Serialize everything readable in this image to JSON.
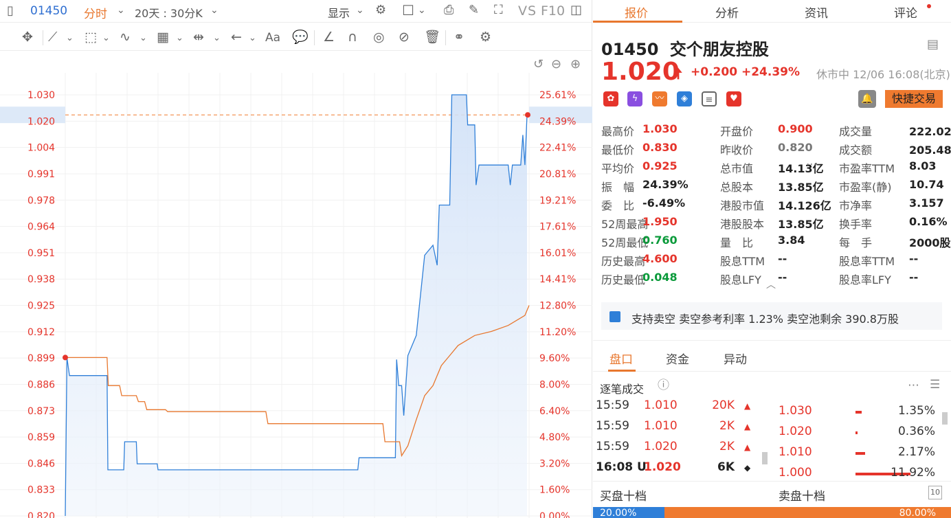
{
  "toolbar": {
    "code": "01450",
    "period": "分时",
    "range": "20天 : 30分K",
    "display": "显示",
    "vs": "VS",
    "f10": "F10",
    "text_tool": "Aa"
  },
  "chart": {
    "left_axis": [
      "1.030",
      "1.020",
      "1.004",
      "0.991",
      "0.978",
      "0.964",
      "0.951",
      "0.938",
      "0.925",
      "0.912",
      "0.899",
      "0.886",
      "0.873",
      "0.859",
      "0.846",
      "0.833",
      "0.820"
    ],
    "right_axis": [
      "25.61%",
      "24.39%",
      "22.41%",
      "20.81%",
      "19.21%",
      "17.61%",
      "16.01%",
      "14.41%",
      "12.80%",
      "11.20%",
      "9.60%",
      "8.00%",
      "6.40%",
      "4.80%",
      "3.20%",
      "1.60%",
      "0.00%"
    ],
    "current_price_label": "1.020",
    "current_pct_label": "24.39%"
  },
  "chart_data": {
    "type": "line",
    "ylim": [
      0.82,
      1.03
    ],
    "series": [],
    "price_points": [
      [
        0,
        0.82
      ],
      [
        0.4,
        0.899
      ],
      [
        1,
        0.89
      ],
      [
        10,
        0.89
      ],
      [
        10.2,
        0.843
      ],
      [
        14,
        0.843
      ],
      [
        14.2,
        0.857
      ],
      [
        17,
        0.857
      ],
      [
        17.2,
        0.846
      ],
      [
        22,
        0.846
      ],
      [
        22.2,
        0.843
      ],
      [
        70,
        0.843
      ],
      [
        70.3,
        0.849
      ],
      [
        79,
        0.849
      ],
      [
        79.3,
        0.898
      ],
      [
        79.8,
        0.885
      ],
      [
        80.5,
        0.885
      ],
      [
        81,
        0.87
      ],
      [
        82,
        0.9
      ],
      [
        84,
        0.91
      ],
      [
        86,
        0.95
      ],
      [
        88,
        0.955
      ],
      [
        89,
        0.945
      ],
      [
        89.5,
        0.975
      ],
      [
        92,
        0.975
      ],
      [
        92.5,
        1.03
      ],
      [
        96,
        1.03
      ],
      [
        96.3,
        1.015
      ],
      [
        98,
        1.015
      ],
      [
        98.3,
        0.985
      ],
      [
        99,
        0.995
      ],
      [
        106,
        0.995
      ],
      [
        106.5,
        0.985
      ],
      [
        107,
        0.995
      ],
      [
        109,
        0.995
      ],
      [
        109.5,
        1.01
      ],
      [
        110,
        0.995
      ],
      [
        110.5,
        1.02
      ]
    ],
    "avg_points": [
      [
        0,
        0.899
      ],
      [
        10,
        0.899
      ],
      [
        10.3,
        0.885
      ],
      [
        13,
        0.885
      ],
      [
        13.5,
        0.88
      ],
      [
        17,
        0.88
      ],
      [
        17.5,
        0.877
      ],
      [
        19,
        0.877
      ],
      [
        19.5,
        0.873
      ],
      [
        24,
        0.873
      ],
      [
        24.5,
        0.872
      ],
      [
        48,
        0.872
      ],
      [
        48.5,
        0.866
      ],
      [
        76,
        0.866
      ],
      [
        76.5,
        0.857
      ],
      [
        80,
        0.857
      ],
      [
        80.5,
        0.85
      ],
      [
        82,
        0.855
      ],
      [
        84,
        0.868
      ],
      [
        86,
        0.88
      ],
      [
        88,
        0.885
      ],
      [
        90,
        0.895
      ],
      [
        92,
        0.9
      ],
      [
        94,
        0.905
      ],
      [
        98,
        0.91
      ],
      [
        102,
        0.912
      ],
      [
        106,
        0.915
      ],
      [
        110,
        0.92
      ],
      [
        111,
        0.925
      ]
    ],
    "x_max": 111
  },
  "tabs": [
    "报价",
    "分析",
    "资讯",
    "评论"
  ],
  "quote": {
    "code": "01450",
    "name": "交个朋友控股",
    "price": "1.020",
    "change": "+0.200",
    "change_pct": "+24.39%",
    "status": "休市中 12/06 16:08(北京)",
    "quick_trade": "快捷交易"
  },
  "quote_grid": [
    {
      "label": "最高价",
      "value": "1.030",
      "color": "red"
    },
    {
      "label": "开盘价",
      "value": "0.900",
      "color": "red"
    },
    {
      "label": "成交量",
      "value": "222.02万",
      "color": "dark"
    },
    {
      "label": "最低价",
      "value": "0.830",
      "color": "red"
    },
    {
      "label": "昨收价",
      "value": "0.820",
      "color": "gray"
    },
    {
      "label": "成交额",
      "value": "205.48万",
      "color": "dark"
    },
    {
      "label": "平均价",
      "value": "0.925",
      "color": "red"
    },
    {
      "label": "总市值",
      "value": "14.13亿",
      "color": "dark"
    },
    {
      "label": "市盈率TTM",
      "value": "8.03",
      "color": "dark"
    },
    {
      "label": "振　幅",
      "value": "24.39%",
      "color": "dark"
    },
    {
      "label": "总股本",
      "value": "13.85亿",
      "color": "dark"
    },
    {
      "label": "市盈率(静)",
      "value": "10.74",
      "color": "dark"
    },
    {
      "label": "委　比",
      "value": "-6.49%",
      "color": "dark"
    },
    {
      "label": "港股市值",
      "value": "14.126亿",
      "color": "dark"
    },
    {
      "label": "市净率",
      "value": "3.157",
      "color": "dark"
    },
    {
      "label": "52周最高",
      "value": "1.950",
      "color": "red"
    },
    {
      "label": "港股股本",
      "value": "13.85亿",
      "color": "dark"
    },
    {
      "label": "换手率",
      "value": "0.16%",
      "color": "dark"
    },
    {
      "label": "52周最低",
      "value": "0.760",
      "color": "green"
    },
    {
      "label": "量　比",
      "value": "3.84",
      "color": "dark"
    },
    {
      "label": "每　手",
      "value": "2000股",
      "color": "dark"
    },
    {
      "label": "历史最高",
      "value": "4.600",
      "color": "red"
    },
    {
      "label": "股息TTM",
      "value": "--",
      "color": "dark"
    },
    {
      "label": "股息率TTM",
      "value": "--",
      "color": "dark"
    },
    {
      "label": "历史最低",
      "value": "0.048",
      "color": "green"
    },
    {
      "label": "股息LFY",
      "value": "--",
      "color": "dark"
    },
    {
      "label": "股息率LFY",
      "value": "--",
      "color": "dark"
    }
  ],
  "short_info": "支持卖空 卖空参考利率 1.23% 卖空池剩余 390.8万股",
  "subtabs": [
    "盘口",
    "资金",
    "异动"
  ],
  "trades_title": "逐笔成交",
  "trades": [
    {
      "time": "15:59",
      "price": "1.010",
      "vol": "20K",
      "dir": "▲"
    },
    {
      "time": "15:59",
      "price": "1.010",
      "vol": "2K",
      "dir": "▲"
    },
    {
      "time": "15:59",
      "price": "1.020",
      "vol": "2K",
      "dir": "▲"
    },
    {
      "time": "16:08 U",
      "price": "1.020",
      "vol": "6K",
      "dir": "◆"
    }
  ],
  "levels": [
    {
      "price": "1.030",
      "pct": "1.35%",
      "bar": 0.11
    },
    {
      "price": "1.020",
      "pct": "0.36%",
      "bar": 0.03
    },
    {
      "price": "1.010",
      "pct": "2.17%",
      "bar": 0.18
    },
    {
      "price": "1.000",
      "pct": "11.92%",
      "bar": 1.0
    }
  ],
  "book": {
    "bid_label": "买盘十档",
    "ask_label": "卖盘十档",
    "bid_pct": "20.00%",
    "ask_pct": "80.00%",
    "bid_ratio": 0.2
  },
  "colors": {
    "accent": "#e8772e",
    "up": "#e5342b",
    "down": "#0a9a3a",
    "line": "#2f7fd8"
  }
}
